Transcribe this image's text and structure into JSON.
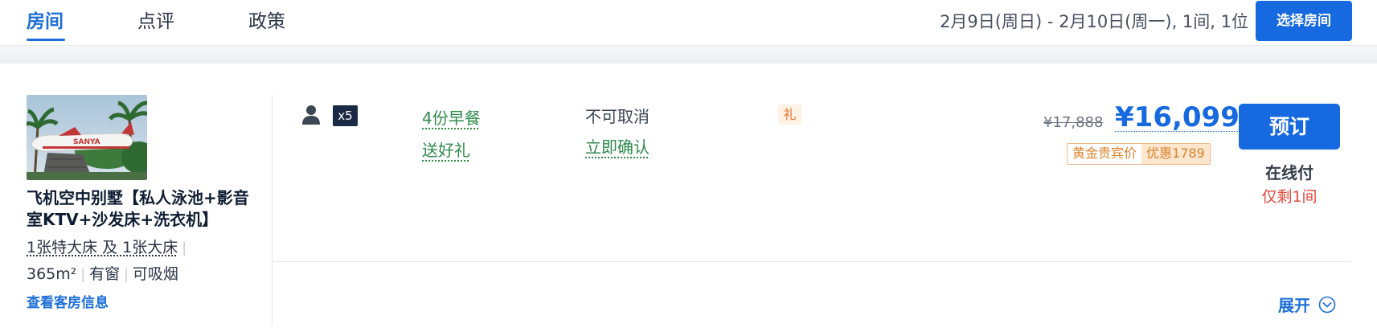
{
  "tabs": [
    {
      "label": "房间",
      "active": true
    },
    {
      "label": "点评",
      "active": false
    },
    {
      "label": "政策",
      "active": false
    }
  ],
  "stay_summary": "2月9日(周日) - 2月10日(周一), 1间, 1位",
  "select_room_label": "选择房间",
  "room": {
    "name": "飞机空中别墅【私人泳池+影音室KTV+沙发床+洗衣机】",
    "bed": "1张特大床 及 1张大床",
    "area": "365m²",
    "window": "有窗",
    "smoking": "可吸烟",
    "info_link": "查看客房信息",
    "photo_text": "SANYA"
  },
  "rate": {
    "guest_icon": "person-icon",
    "guest_count": "x5",
    "perks": [
      "4份早餐",
      "送好礼"
    ],
    "policies": [
      "不可取消",
      "立即确认"
    ],
    "gift_badge": "礼",
    "original_price": "¥17,888",
    "price": "¥16,099",
    "member_label": "黄金贵宾价",
    "discount_label": "优惠1789",
    "book_label": "预订",
    "payment": "在线付",
    "availability": "仅剩1间"
  },
  "expand_label": "展开",
  "colors": {
    "brand_blue": "#1769e0",
    "perk_green": "#2f8a4c",
    "alert_red": "#e04b3e",
    "promo_orange": "#d9822b"
  }
}
